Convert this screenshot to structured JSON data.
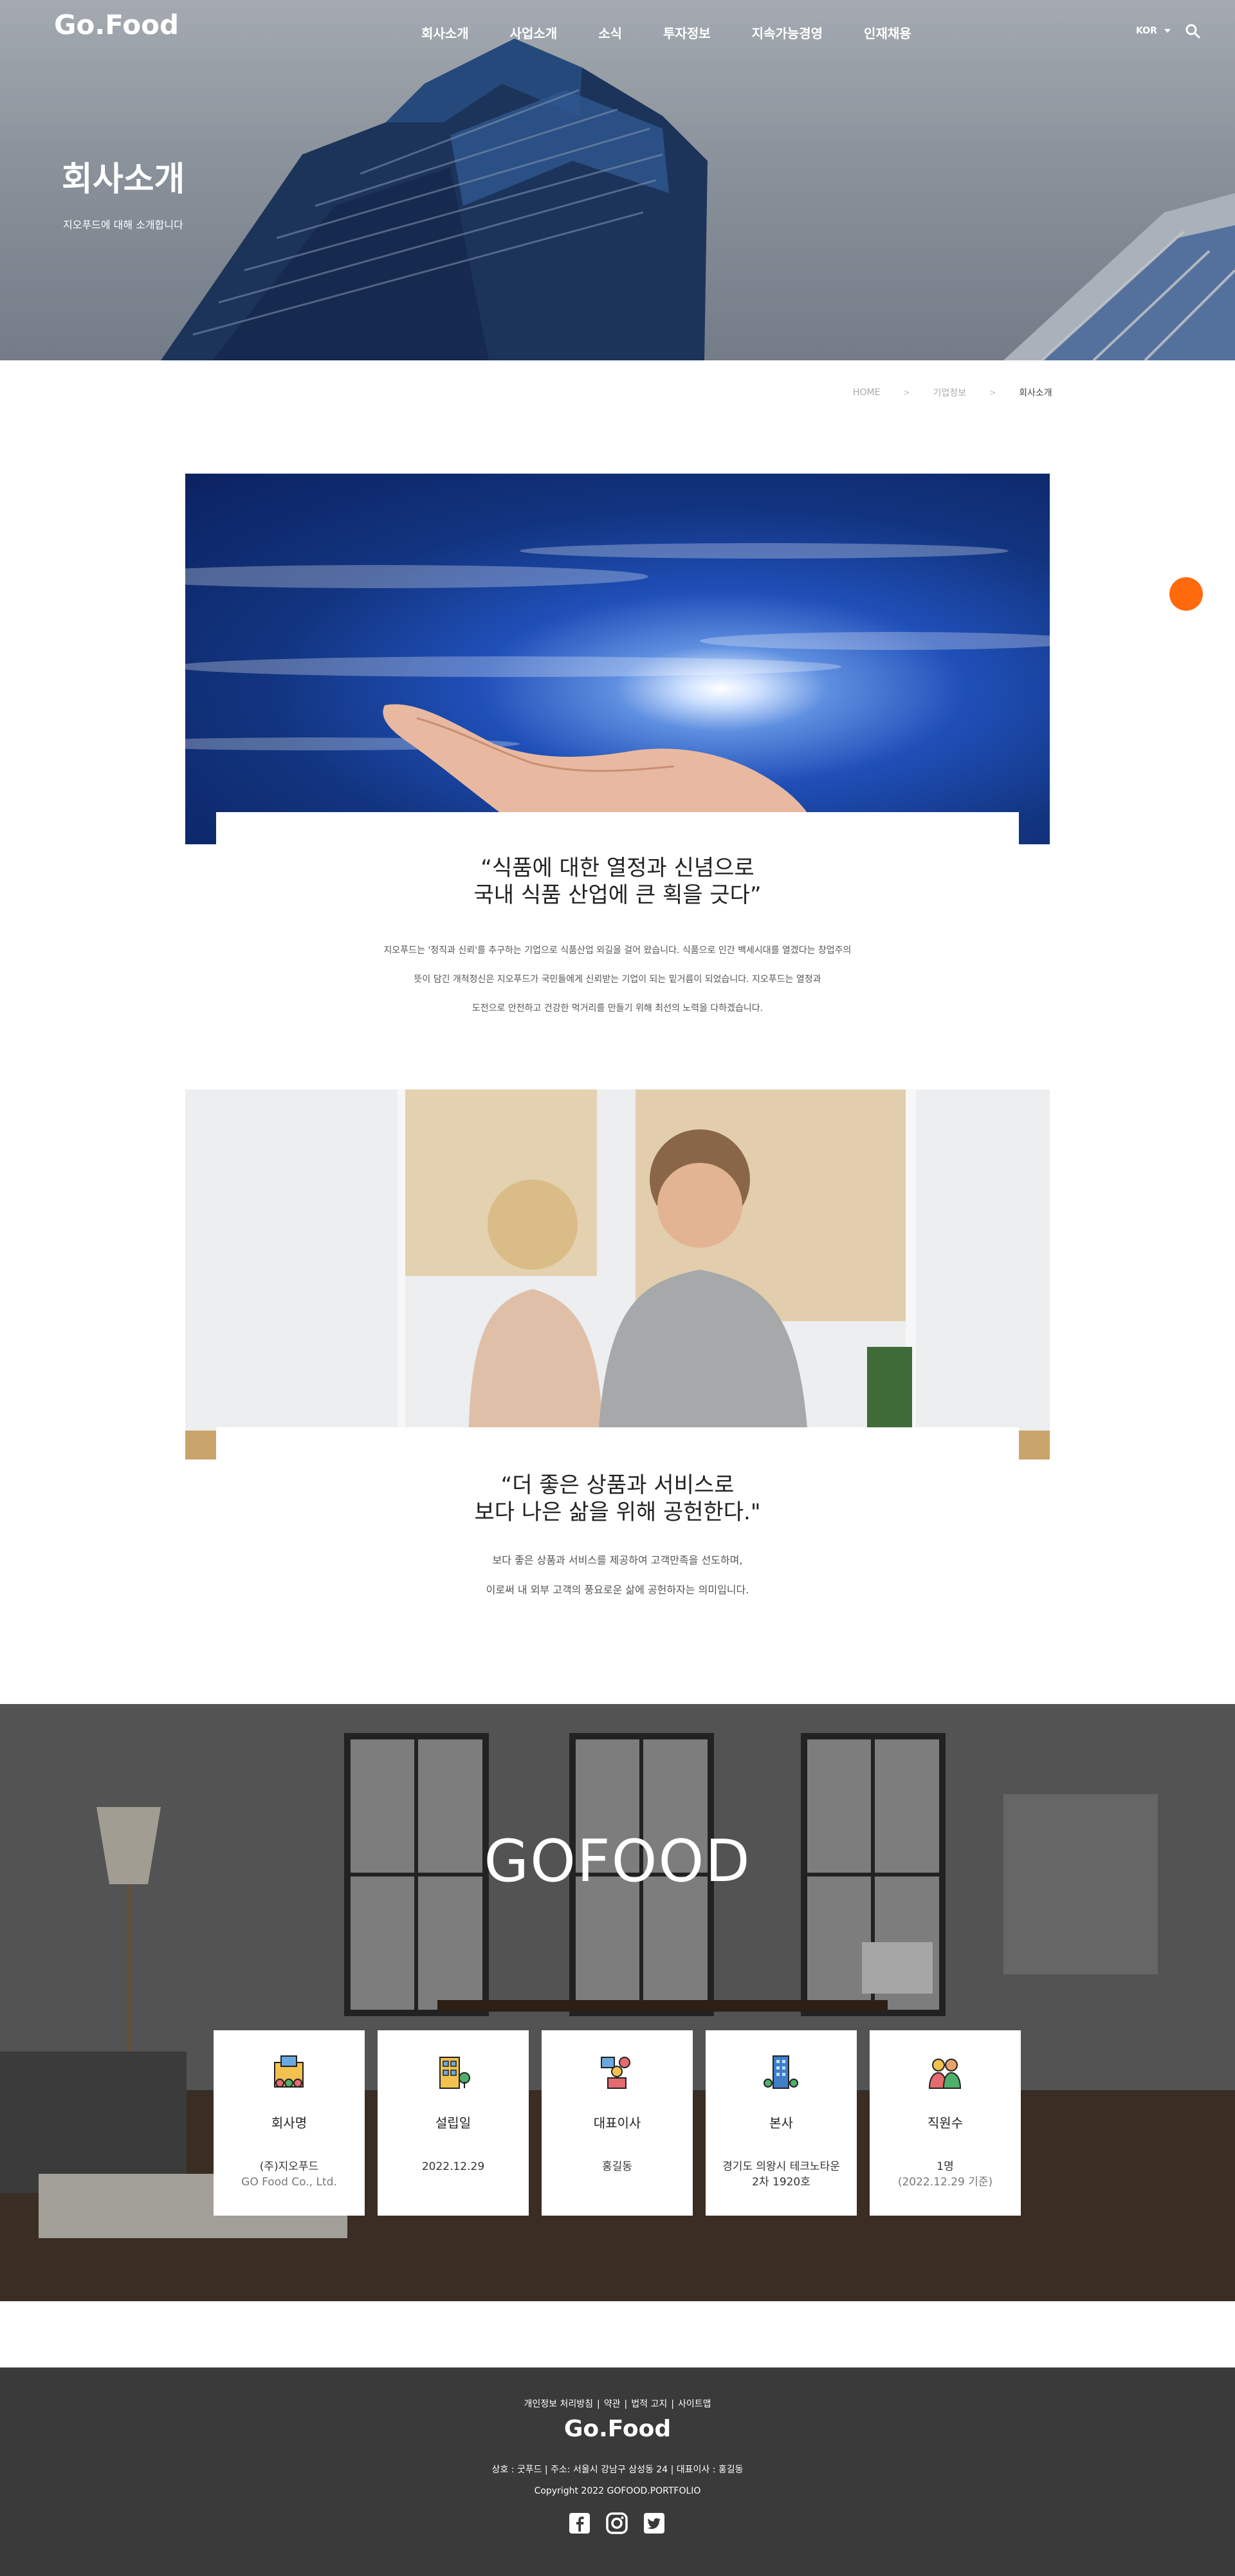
{
  "header": {
    "logo": "Go.Food",
    "nav": [
      "회사소개",
      "사업소개",
      "소식",
      "투자정보",
      "지속가능경영",
      "인재채용"
    ],
    "lang": "KOR",
    "search_icon": "search-icon"
  },
  "hero": {
    "title": "회사소개",
    "subtitle": "지오푸드에 대해 소개합니다"
  },
  "breadcrumb": [
    "HOME",
    "기업정보",
    "회사소개"
  ],
  "section1": {
    "title_line1": "“식품에 대한 열정과 신념으로",
    "title_line2": "국내 식품 산업에 큰 획을 긋다”",
    "text_line1": "지오푸드는 '정직과 신뢰'를 추구하는 기업으로 식품산업 외길을 걸어 왔습니다. 식품으로 인간 백세시대를 열겠다는 창업주의",
    "text_line2": "뜻이 담긴 개척정신은 지오푸드가 국민들에게 신뢰받는 기업이 되는 밑거름이 되었습니다. 지오푸드는 열정과",
    "text_line3": "도전으로 안전하고 건강한 먹거리를 만들기 위해 최선의 노력을 다하겠습니다."
  },
  "section2": {
    "title_line1": "“더 좋은 상품과 서비스로",
    "title_line2": "보다 나은 삶을 위해 공헌한다.\"",
    "text_line1": "보다 좋은 상품과 서비스를 제공하여 고객만족을 선도하며,",
    "text_line2": "이로써 내 외부 고객의 풍요로운 삶에 공헌하자는 의미입니다."
  },
  "gofood": {
    "title": "GOFOOD",
    "cards": [
      {
        "label": "회사명",
        "value": "(주)지오푸드",
        "value2": "GO Food Co., Ltd.",
        "icon": "company-buildings-icon"
      },
      {
        "label": "설립일",
        "value": "2022.12.29",
        "value2": "",
        "icon": "building-tree-icon"
      },
      {
        "label": "대표이사",
        "value": "홍길동",
        "value2": "",
        "icon": "ceo-desk-icon"
      },
      {
        "label": "본사",
        "value": "경기도 의왕시 테크노타운",
        "value2": "2차 1920호",
        "icon": "headquarters-tower-icon"
      },
      {
        "label": "직원수",
        "value": "1명",
        "value2": "(2022.12.29 기준)",
        "icon": "employees-icon"
      }
    ]
  },
  "footer": {
    "links": [
      "개인정보 처리방침",
      "약관",
      "법적 고지",
      "사이트맵"
    ],
    "logo": "Go.Food",
    "info": "상호 : 굿푸드 | 주소: 서울시 강남구 삼성동 24 | 대표이사 : 홍길동",
    "copyright": "Copyright 2022 GOFOOD.PORTFOLIO",
    "socials": [
      "facebook-icon",
      "instagram-icon",
      "twitter-icon"
    ]
  },
  "colors": {
    "accent": "#ff6a0d",
    "footer_bg": "#3a3a3a"
  }
}
